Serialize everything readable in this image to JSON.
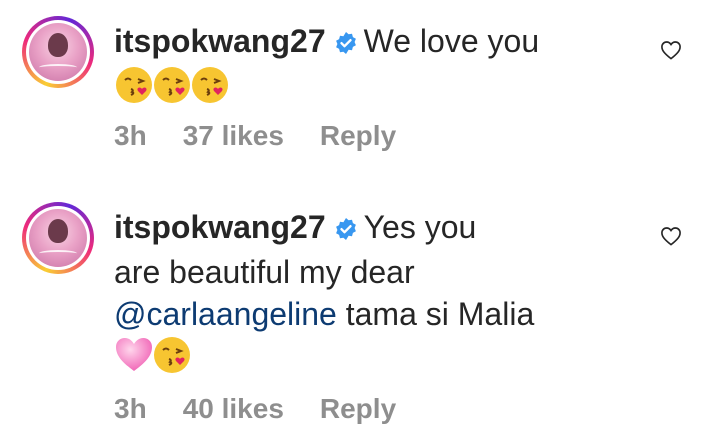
{
  "comments": [
    {
      "username": "itspokwang27",
      "verified": true,
      "text": "We love you",
      "emojis": [
        "kissing-face-emoji",
        "kissing-face-emoji",
        "kissing-face-emoji"
      ],
      "time": "3h",
      "likes": "37 likes",
      "reply_label": "Reply"
    },
    {
      "username": "itspokwang27",
      "verified": true,
      "text_part1": "Yes you",
      "text_part2": "are beautiful my dear",
      "mention": "@carlaangeline",
      "text_part3": "tama si Malia",
      "emojis": [
        "pink-heart-emoji",
        "kissing-face-emoji"
      ],
      "time": "3h",
      "likes": "40 likes",
      "reply_label": "Reply"
    }
  ],
  "colors": {
    "text": "#262626",
    "meta": "#8e8e8e",
    "verified": "#3897f0",
    "mention": "#0d3b72"
  },
  "icons": {
    "verified": "verified-badge-icon",
    "like": "heart-outline-icon"
  }
}
